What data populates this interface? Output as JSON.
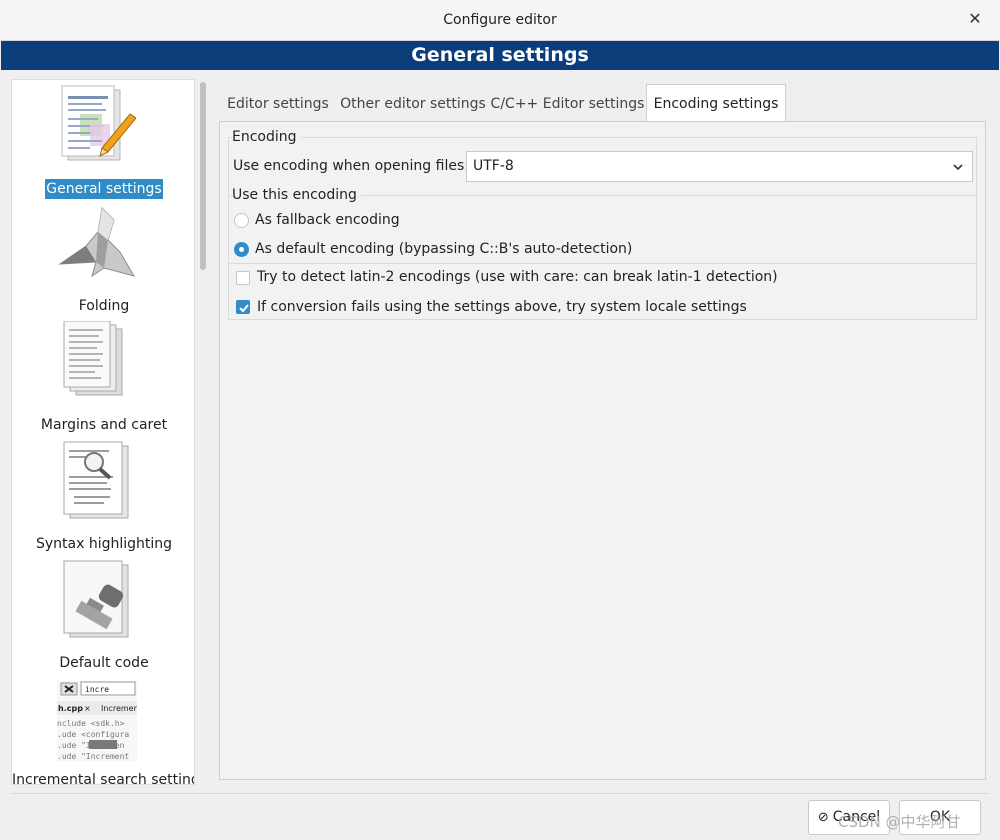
{
  "window": {
    "title": "Configure editor",
    "close_glyph": "✕"
  },
  "banner": {
    "title": "General settings"
  },
  "sidebar": {
    "items": [
      {
        "label": "General settings",
        "icon": "pencil-document-icon",
        "selected": true
      },
      {
        "label": "Folding",
        "icon": "origami-bird-icon",
        "selected": false
      },
      {
        "label": "Margins and caret",
        "icon": "stacked-pages-icon",
        "selected": false
      },
      {
        "label": "Syntax highlighting",
        "icon": "magnifier-document-icon",
        "selected": false
      },
      {
        "label": "Default code",
        "icon": "stamp-document-icon",
        "selected": false
      },
      {
        "label": "Incremental search settings",
        "icon": "incremental-search-icon",
        "selected": false
      }
    ],
    "incremental_preview": {
      "search_text": "incre",
      "tab_file": "h.cpp",
      "tab_close": "×",
      "tab_other": "Incremen",
      "code_lines": [
        "nclude <sdk.h>",
        ".ude <configura",
        ".ude \"Incremen",
        ".ude \"Increment"
      ]
    }
  },
  "tabs": [
    {
      "label": "Editor settings",
      "active": false
    },
    {
      "label": "Other editor settings",
      "active": false
    },
    {
      "label": "C/C++ Editor settings",
      "active": false
    },
    {
      "label": "Encoding settings",
      "active": true
    }
  ],
  "encoding": {
    "group_title": "Encoding",
    "open_label": "Use encoding when opening files:",
    "selected_encoding": "UTF-8",
    "use_this_group": {
      "title": "Use this encoding",
      "options": [
        {
          "label": "As fallback encoding",
          "checked": false
        },
        {
          "label": "As default encoding (bypassing C::B's auto-detection)",
          "checked": true
        }
      ]
    },
    "checkboxes": [
      {
        "label": "Try to detect latin-2 encodings (use with care: can break latin-1 detection)",
        "checked": false
      },
      {
        "label": "If conversion fails using the settings above, try system locale settings",
        "checked": true
      }
    ]
  },
  "buttons": {
    "cancel": "Cancel",
    "cancel_glyph": "⊘",
    "ok": "OK"
  },
  "watermark": "CSDN @中华阿甘",
  "colors": {
    "banner": "#0b3d7a",
    "accent": "#308cc6"
  }
}
